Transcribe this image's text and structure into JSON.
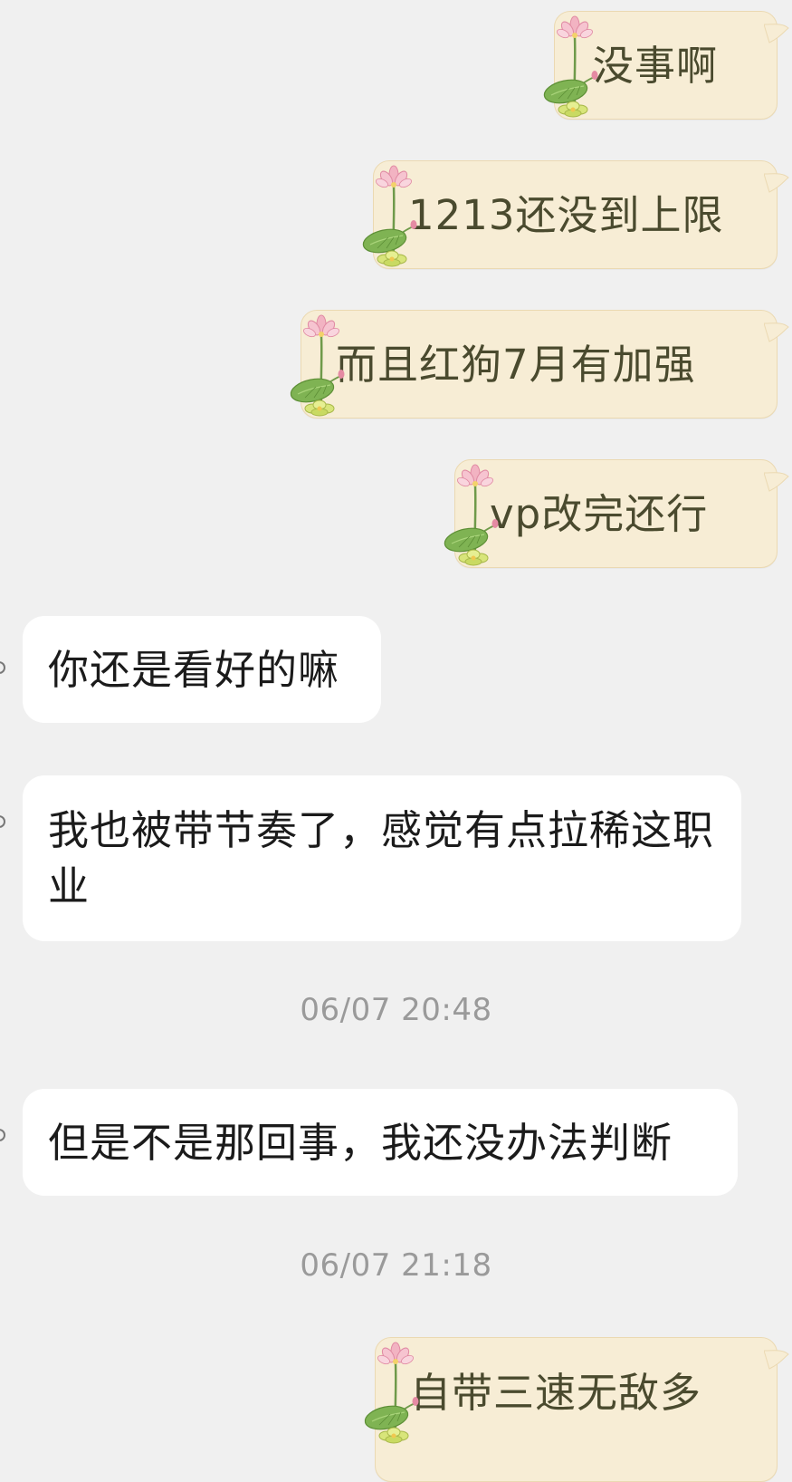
{
  "colors": {
    "background": "#f0f0f0",
    "outgoing_bubble": "#f7edd5",
    "outgoing_border": "#ebd9b2",
    "incoming_bubble": "#ffffff",
    "outgoing_text": "#4a4a2e",
    "incoming_text": "#1b1b1b",
    "timestamp": "#9a9a9a"
  },
  "decoration": {
    "bubble_sticker_icon": "lotus-icon"
  },
  "messages": [
    {
      "direction": "outgoing",
      "text": "没事啊"
    },
    {
      "direction": "outgoing",
      "text": "1213还没到上限"
    },
    {
      "direction": "outgoing",
      "text": "而且红狗7月有加强"
    },
    {
      "direction": "outgoing",
      "text": "vp改完还行"
    },
    {
      "direction": "incoming",
      "text": "你还是看好的嘛"
    },
    {
      "direction": "incoming",
      "text": "我也被带节奏了，感觉有点拉稀这职业"
    },
    {
      "type": "timestamp",
      "text": "06/07 20:48"
    },
    {
      "direction": "incoming",
      "text": "但是不是那回事，我还没办法判断"
    },
    {
      "type": "timestamp",
      "text": "06/07 21:18"
    },
    {
      "direction": "outgoing",
      "text": "自带三速无敌多"
    }
  ]
}
